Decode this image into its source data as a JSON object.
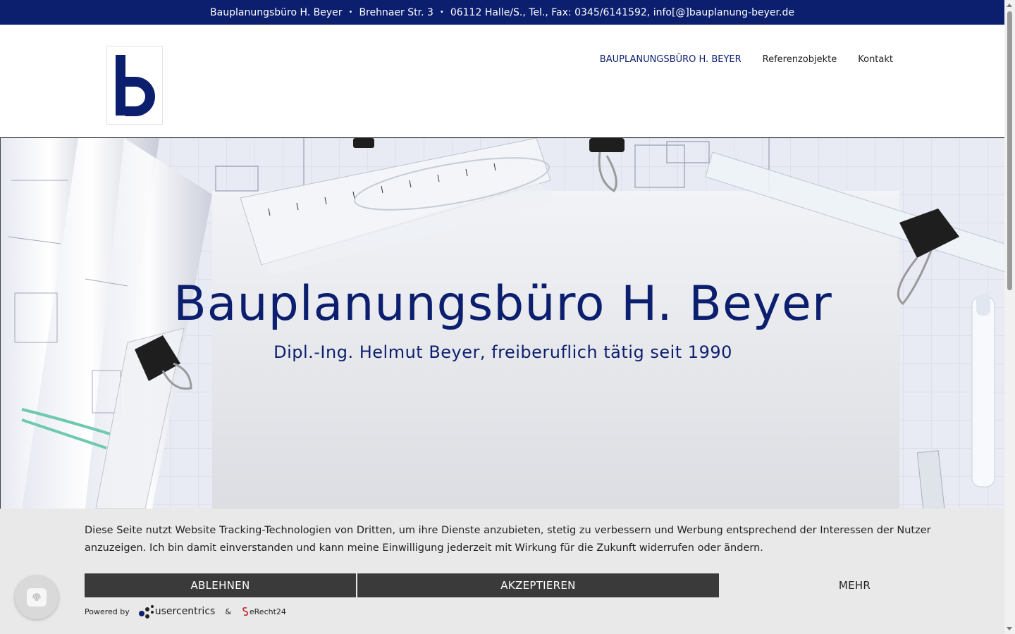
{
  "topbar": {
    "name": "Bauplanungsbüro H. Beyer",
    "street": "Brehnaer Str. 3",
    "contact": "06112 Halle/S., Tel., Fax: 0345/6141592, info[@]bauplanung-beyer.de"
  },
  "nav": {
    "items": [
      {
        "label": "BAUPLANUNGSBÜRO H. BEYER"
      },
      {
        "label": "Referenzobjekte"
      },
      {
        "label": "Kontakt"
      }
    ]
  },
  "hero": {
    "title": "Bauplanungsbüro H. Beyer",
    "subtitle": "Dipl.-Ing. Helmut Beyer, freiberuflich tätig seit 1990"
  },
  "cookie": {
    "text": "Diese Seite nutzt Website Tracking-Technologien von Dritten, um ihre Dienste anzubieten, stetig zu verbessern und Werbung entsprechend der Interessen der Nutzer anzuzeigen. Ich bin damit einverstanden und kann meine Einwilligung jederzeit mit Wirkung für die Zukunft widerrufen oder ändern.",
    "reject_label": "ABLEHNEN",
    "accept_label": "AKZEPTIEREN",
    "more_label": "MEHR",
    "powered_label": "Powered by",
    "usercentrics_label": "usercentrics",
    "amp": "&",
    "erecht_label": "eRecht24"
  },
  "colors": {
    "brand": "#0b1f6e",
    "button_dark": "#3a3a3a",
    "banner_bg": "#e9e9e9"
  },
  "icons": {
    "logo": "letter-b-logo",
    "privacy": "fingerprint-icon"
  }
}
